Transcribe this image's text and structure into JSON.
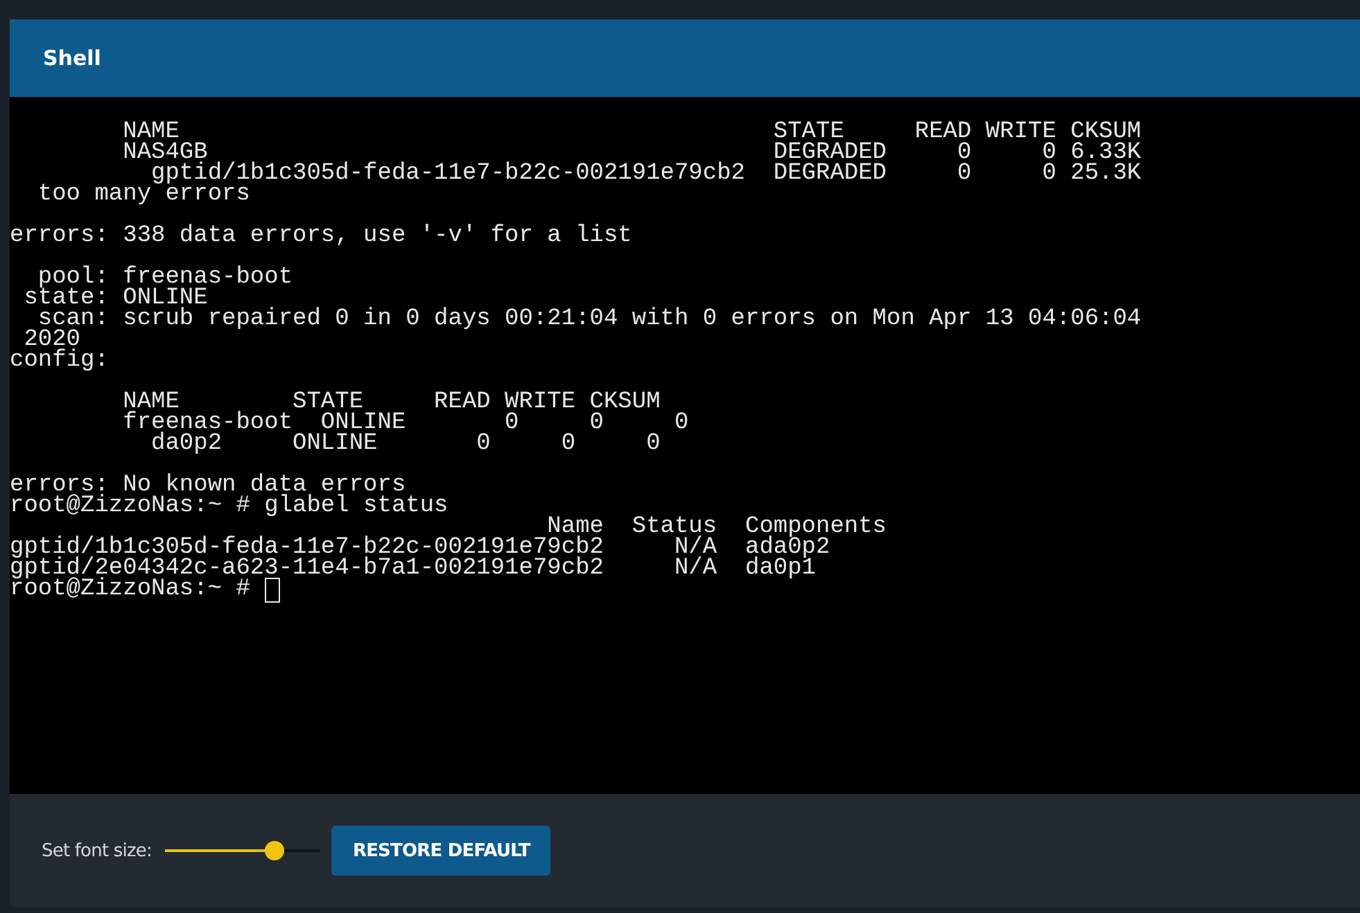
{
  "window": {
    "title": "Shell"
  },
  "terminal": {
    "blocks": [
      [
        "        NAME                                          STATE     READ WRITE CKSUM",
        "        NAS4GB                                        DEGRADED     0     0 6.33K",
        "          gptid/1b1c305d-feda-11e7-b22c-002191e79cb2  DEGRADED     0     0 25.3K",
        "  too many errors"
      ],
      [
        "errors: 338 data errors, use '-v' for a list"
      ],
      [
        "  pool: freenas-boot",
        " state: ONLINE",
        "  scan: scrub repaired 0 in 0 days 00:21:04 with 0 errors on Mon Apr 13 04:06:04",
        " 2020",
        "config:"
      ],
      [
        "        NAME        STATE     READ WRITE CKSUM",
        "        freenas-boot  ONLINE       0     0     0",
        "          da0p2     ONLINE       0     0     0"
      ],
      [
        "errors: No known data errors",
        "root@ZizzoNas:~ # glabel status",
        "                                      Name  Status  Components",
        "gptid/1b1c305d-feda-11e7-b22c-002191e79cb2     N/A  ada0p2",
        "gptid/2e04342c-a623-11e4-b7a1-002191e79cb2     N/A  da0p1",
        "root@ZizzoNas:~ # "
      ]
    ],
    "cursor": true
  },
  "footer": {
    "font_size_label": "Set font size:",
    "font_size_slider": {
      "level": 0.7
    },
    "restore_button": "RESTORE DEFAULT"
  }
}
